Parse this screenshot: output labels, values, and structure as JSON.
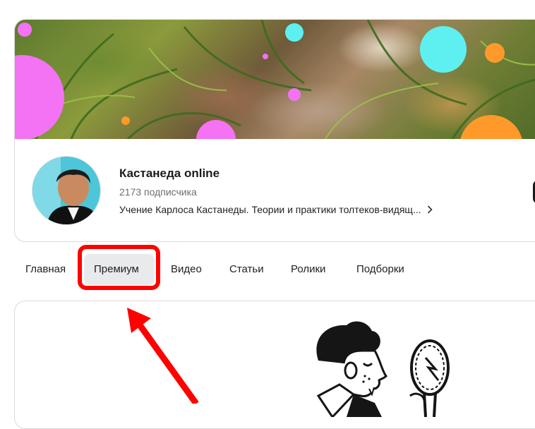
{
  "channel": {
    "title": "Кастанеда online",
    "subscribers": "2173 подписчика",
    "description": "Учение Карлоса Кастанеды. Теории и практики толтеков-видящ..."
  },
  "tabs": [
    {
      "label": "Главная",
      "active": false
    },
    {
      "label": "Премиум",
      "active": true
    },
    {
      "label": "Видео",
      "active": false
    },
    {
      "label": "Статьи",
      "active": false
    },
    {
      "label": "Ролики",
      "active": false
    },
    {
      "label": "Подборки",
      "active": false
    }
  ],
  "annotation": {
    "highlight_color": "#ff0000",
    "arrow_color": "#ff0000"
  },
  "colors": {
    "tab_active_bg": "#e9eaeb",
    "cover_dot_pink": "#f472f4",
    "cover_dot_cyan": "#5ef0f0",
    "cover_dot_orange": "#ff9a2a"
  }
}
